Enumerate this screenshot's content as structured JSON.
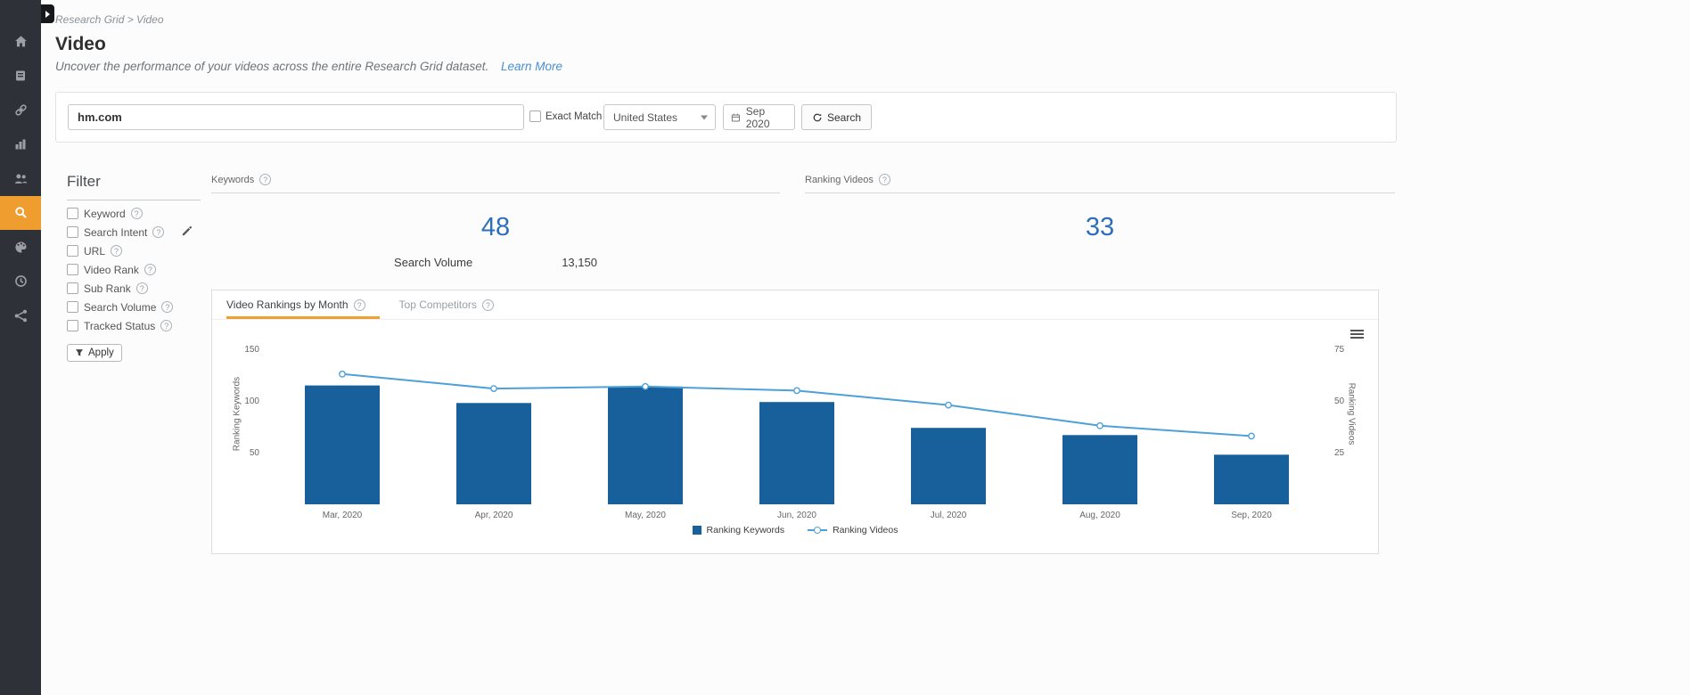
{
  "page": {
    "breadcrumb": "Research Grid > Video",
    "title": "Video",
    "subtitle": "Uncover the performance of your videos across the entire Research Grid dataset.",
    "learn_more_label": "Learn More"
  },
  "sidebar": {
    "icons": [
      "home-icon",
      "reports-icon",
      "links-icon",
      "analytics-icon",
      "audience-icon",
      "search-icon",
      "brand-icon",
      "history-icon",
      "network-icon"
    ],
    "active_icon": "search-icon"
  },
  "search_bar": {
    "query": "hm.com",
    "exact_match_label": "Exact Match",
    "country_selected": "United States",
    "month": "Sep 2020",
    "search_button_label": "Search"
  },
  "filter_panel": {
    "title": "Filter",
    "apply_label": "Apply",
    "items": [
      {
        "label": "Keyword"
      },
      {
        "label": "Search Intent"
      },
      {
        "label": "URL"
      },
      {
        "label": "Video Rank"
      },
      {
        "label": "Sub Rank"
      },
      {
        "label": "Search Volume"
      },
      {
        "label": "Tracked Status"
      }
    ]
  },
  "stats": {
    "keywords": {
      "header": "Keywords",
      "count": "48",
      "search_volume_label": "Search Volume",
      "search_volume_value": "13,150"
    },
    "ranking_videos": {
      "header": "Ranking Videos",
      "count": "33"
    }
  },
  "chart_card": {
    "tabs": [
      {
        "label": "Video Rankings by Month",
        "active": true
      },
      {
        "label": "Top Competitors",
        "active": false
      }
    ]
  },
  "colors": {
    "sidebar_bg": "#2e3238",
    "accent_orange": "#ef9d2f",
    "tab_underline_orange": "#f0a030",
    "bar_blue": "#17609c",
    "line_blue": "#4da1d8",
    "stat_blue": "#2d6fb8",
    "link_blue": "#4a90d2"
  },
  "chart_data": {
    "type": "bar",
    "subtype": "bar+line dual axis",
    "categories": [
      "Mar, 2020",
      "Apr, 2020",
      "May, 2020",
      "Jun, 2020",
      "Jul, 2020",
      "Aug, 2020",
      "Sep, 2020"
    ],
    "series": [
      {
        "name": "Ranking Keywords",
        "type": "bar",
        "axis": "left",
        "color": "#17609c",
        "values": [
          115,
          98,
          114,
          99,
          74,
          67,
          48
        ]
      },
      {
        "name": "Ranking Videos",
        "type": "line",
        "axis": "right",
        "color": "#4da1d8",
        "values": [
          63,
          56,
          57,
          55,
          48,
          38,
          33
        ]
      }
    ],
    "left_axis": {
      "title": "Ranking Keywords",
      "min": 0,
      "max": 150,
      "ticks": [
        50,
        100,
        150
      ]
    },
    "right_axis": {
      "title": "Ranking Videos",
      "min": 0,
      "max": 75,
      "ticks": [
        25,
        50,
        75
      ]
    },
    "grid": false,
    "legend_position": "bottom"
  }
}
